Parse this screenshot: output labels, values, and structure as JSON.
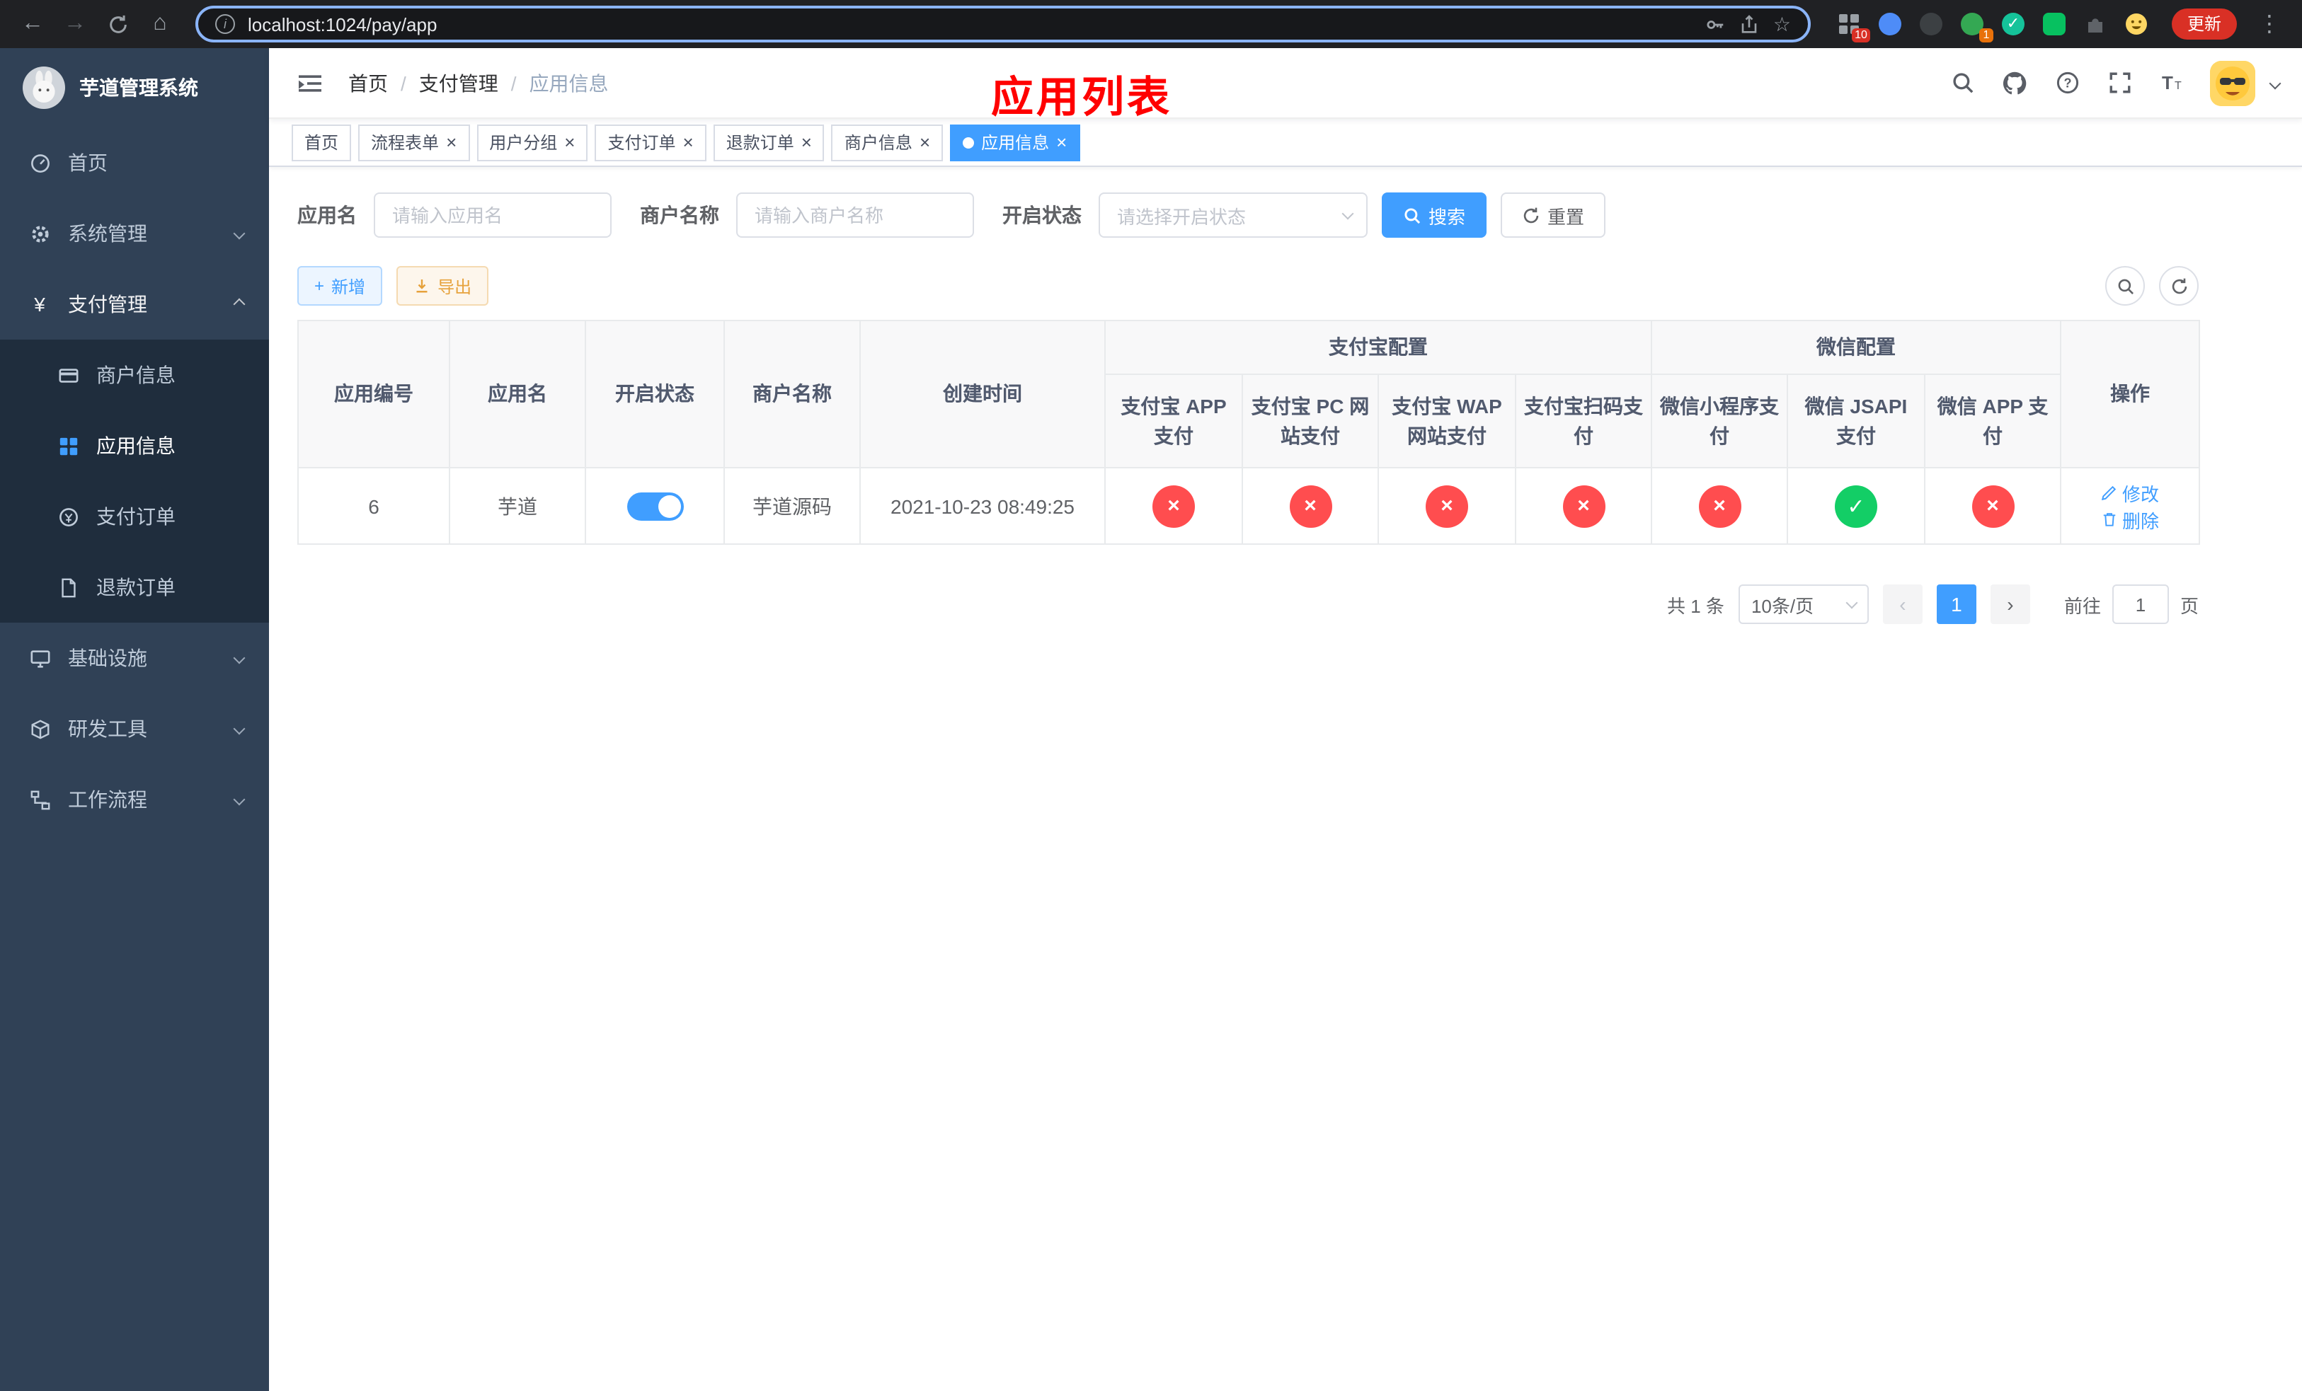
{
  "colors": {
    "primary": "#409eff",
    "danger": "#ff4d4f",
    "success": "#13ce66",
    "annotation_red": "#ff0000",
    "sidebar_bg": "#304156",
    "submenu_bg": "#1f2d3d"
  },
  "icons": {
    "back": "←",
    "forward": "→",
    "home": "⌂",
    "star": "☆",
    "menu": "⋮",
    "info": "i",
    "close": "×",
    "check": "✓",
    "cross": "×",
    "plus": "+",
    "prev": "‹",
    "next": "›",
    "yen": "¥"
  },
  "browser": {
    "url": "localhost:1024/pay/app",
    "update_label": "更新",
    "ext_badge_grid": "10",
    "ext_badge_translate": "1"
  },
  "sidebar": {
    "title": "芋道管理系统",
    "items": [
      {
        "label": "首页"
      },
      {
        "label": "系统管理"
      },
      {
        "label": "支付管理"
      },
      {
        "label": "基础设施"
      },
      {
        "label": "研发工具"
      },
      {
        "label": "工作流程"
      }
    ],
    "submenu": [
      {
        "label": "商户信息"
      },
      {
        "label": "应用信息"
      },
      {
        "label": "支付订单"
      },
      {
        "label": "退款订单"
      }
    ]
  },
  "header": {
    "breadcrumb": [
      {
        "label": "首页"
      },
      {
        "label": "支付管理"
      },
      {
        "label": "应用信息"
      }
    ],
    "annotation": "应用列表"
  },
  "tabs": [
    {
      "label": "首页"
    },
    {
      "label": "流程表单"
    },
    {
      "label": "用户分组"
    },
    {
      "label": "支付订单"
    },
    {
      "label": "退款订单"
    },
    {
      "label": "商户信息"
    },
    {
      "label": "应用信息"
    }
  ],
  "filters": {
    "app_name_label": "应用名",
    "app_name_placeholder": "请输入应用名",
    "merchant_label": "商户名称",
    "merchant_placeholder": "请输入商户名称",
    "status_label": "开启状态",
    "status_placeholder": "请选择开启状态",
    "search_label": "搜索",
    "reset_label": "重置"
  },
  "toolbar": {
    "add_label": "新增",
    "export_label": "导出"
  },
  "table": {
    "headers": {
      "app_id": "应用编号",
      "app_name": "应用名",
      "status": "开启状态",
      "merchant": "商户名称",
      "created": "创建时间",
      "alipay_group": "支付宝配置",
      "wechat_group": "微信配置",
      "actions": "操作",
      "sub": [
        "支付宝 APP 支付",
        "支付宝 PC 网站支付",
        "支付宝 WAP 网站支付",
        "支付宝扫码支付",
        "微信小程序支付",
        "微信 JSAPI 支付",
        "微信 APP 支付"
      ]
    },
    "rows": [
      {
        "app_id": "6",
        "app_name": "芋道",
        "status_on": true,
        "merchant": "芋道源码",
        "created": "2021-10-23 08:49:25",
        "channels": [
          "fail",
          "fail",
          "fail",
          "fail",
          "fail",
          "ok",
          "fail"
        ],
        "edit_label": "修改",
        "delete_label": "删除"
      }
    ]
  },
  "pagination": {
    "total": "共 1 条",
    "page_size": "10条/页",
    "current_page": "1",
    "goto_prefix": "前往",
    "goto_value": "1",
    "goto_suffix": "页"
  }
}
